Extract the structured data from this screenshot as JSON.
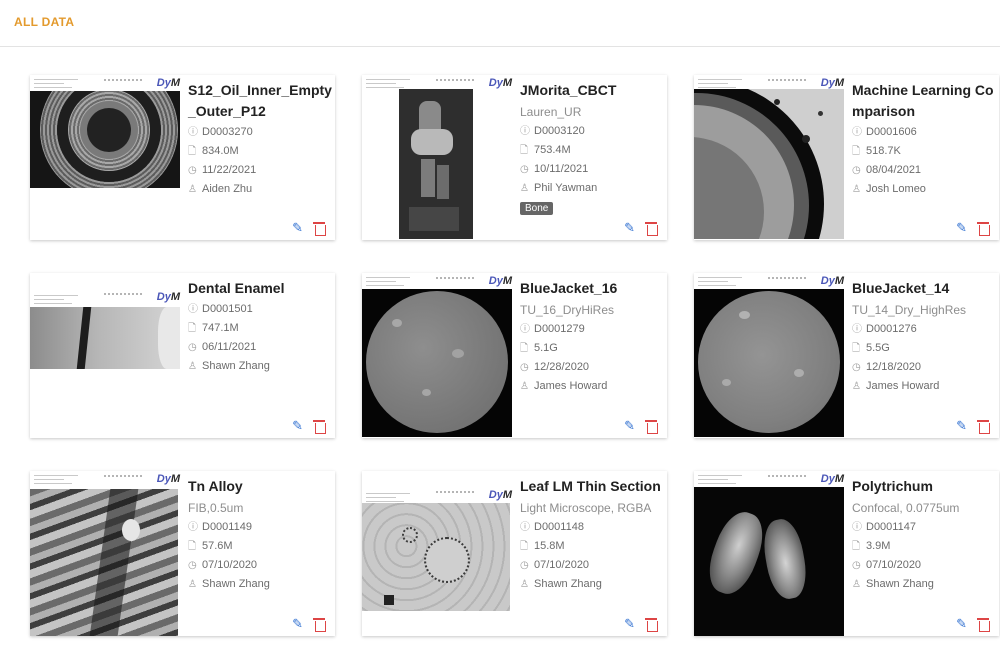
{
  "header": {
    "title": "ALL DATA"
  },
  "logo": {
    "part1": "Dy",
    "part2": "M"
  },
  "icons": {
    "id": "ⓘ",
    "size": "🗋",
    "date": "◷",
    "user": "♙",
    "edit": "✎"
  },
  "colors": {
    "accent": "#e39a2d",
    "edit": "#2f6fd0",
    "delete": "#dd4545"
  },
  "cards": [
    {
      "title": "S12_Oil_Inner_Empty_Outer_P12",
      "subtitle": "",
      "id": "D0003270",
      "size": "834.0M",
      "date": "11/22/2021",
      "owner": "Aiden Zhu",
      "tag": ""
    },
    {
      "title": "JMorita_CBCT",
      "subtitle": "Lauren_UR",
      "id": "D0003120",
      "size": "753.4M",
      "date": "10/11/2021",
      "owner": "Phil Yawman",
      "tag": "Bone"
    },
    {
      "title": "Machine Learning Comparison",
      "subtitle": "",
      "id": "D0001606",
      "size": "518.7K",
      "date": "08/04/2021",
      "owner": "Josh Lomeo",
      "tag": ""
    },
    {
      "title": "Dental Enamel",
      "subtitle": "",
      "id": "D0001501",
      "size": "747.1M",
      "date": "06/11/2021",
      "owner": "Shawn Zhang",
      "tag": ""
    },
    {
      "title": "BlueJacket_16",
      "subtitle": "TU_16_DryHiRes",
      "id": "D0001279",
      "size": "5.1G",
      "date": "12/28/2020",
      "owner": "James Howard",
      "tag": ""
    },
    {
      "title": "BlueJacket_14",
      "subtitle": "TU_14_Dry_HighRes",
      "id": "D0001276",
      "size": "5.5G",
      "date": "12/18/2020",
      "owner": "James Howard",
      "tag": ""
    },
    {
      "title": "Tn Alloy",
      "subtitle": "FIB,0.5um",
      "id": "D0001149",
      "size": "57.6M",
      "date": "07/10/2020",
      "owner": "Shawn Zhang",
      "tag": ""
    },
    {
      "title": "Leaf LM Thin Section",
      "subtitle": "Light Microscope, RGBA",
      "id": "D0001148",
      "size": "15.8M",
      "date": "07/10/2020",
      "owner": "Shawn Zhang",
      "tag": ""
    },
    {
      "title": "Polytrichum",
      "subtitle": "Confocal, 0.0775um",
      "id": "D0001147",
      "size": "3.9M",
      "date": "07/10/2020",
      "owner": "Shawn Zhang",
      "tag": ""
    }
  ]
}
